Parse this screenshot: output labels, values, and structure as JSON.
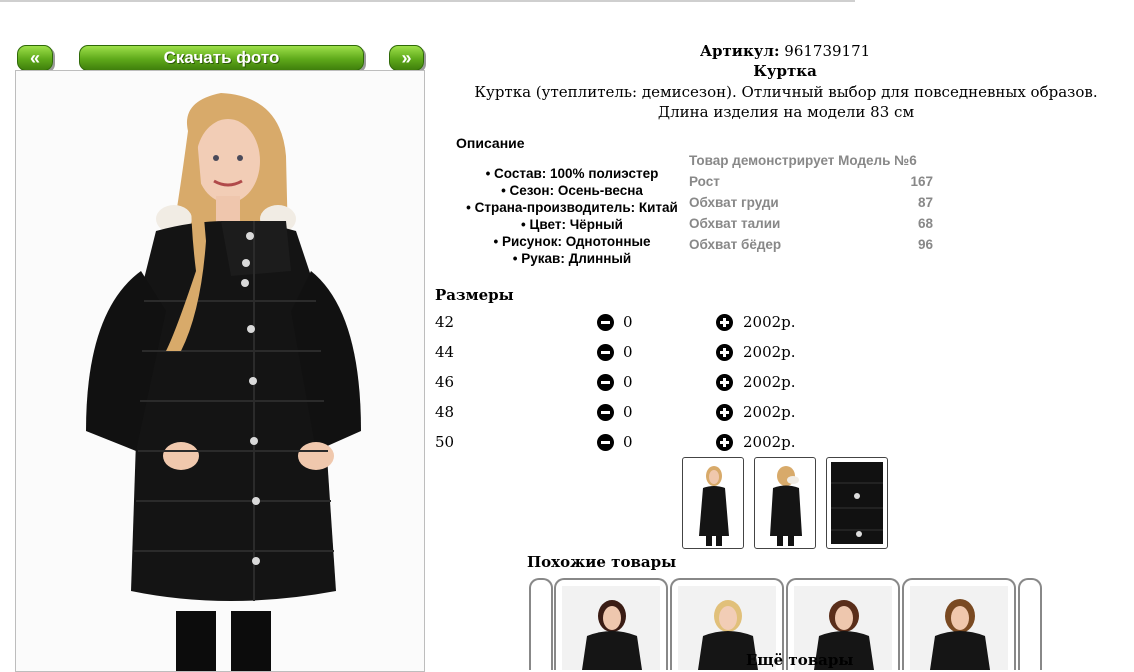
{
  "gallery": {
    "prev_label": "«",
    "download_label": "Скачать фото",
    "next_label": "»"
  },
  "product": {
    "article_label": "Артикул:",
    "article_value": "961739171",
    "title": "Куртка",
    "description": "Куртка (утеплитель: демисезон). Отличный выбор для повседневных образов. Длина изделия на модели 83 см"
  },
  "features": {
    "heading": "Описание",
    "items": [
      "Состав: 100% полиэстер",
      "Сезон: Осень-весна",
      "Страна-производитель: Китай",
      "Цвет: Чёрный",
      "Рисунок: Однотонные",
      "Рукав: Длинный"
    ]
  },
  "model": {
    "heading": "Товар демонстрирует Модель №6",
    "rows": [
      {
        "label": "Рост",
        "value": "167"
      },
      {
        "label": "Обхват груди",
        "value": "87"
      },
      {
        "label": "Обхват талии",
        "value": "68"
      },
      {
        "label": "Обхват бёдер",
        "value": "96"
      }
    ]
  },
  "sizes": {
    "heading": "Размеры",
    "rows": [
      {
        "size": "42",
        "qty": "0",
        "price": "2002р."
      },
      {
        "size": "44",
        "qty": "0",
        "price": "2002р."
      },
      {
        "size": "46",
        "qty": "0",
        "price": "2002р."
      },
      {
        "size": "48",
        "qty": "0",
        "price": "2002р."
      },
      {
        "size": "50",
        "qty": "0",
        "price": "2002р."
      }
    ]
  },
  "similar": {
    "heading": "Похожие товары",
    "more_label": "Ещё товары"
  },
  "colors": {
    "button_green": "#5ea91a",
    "jacket": "#141414",
    "hair_blonde": "#d8aa6a",
    "hair_dark": "#3a1c14"
  }
}
